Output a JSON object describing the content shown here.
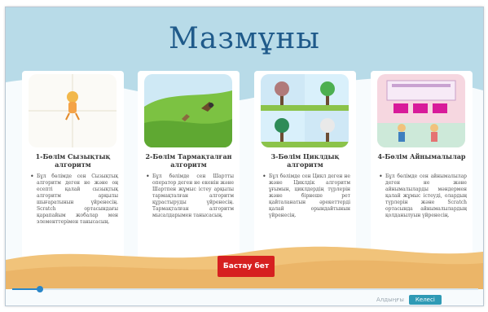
{
  "title": "Мазмұны",
  "cards": [
    {
      "title": "1-Бөлім Сызықтық алгоритм",
      "body": "Бұл бөлімде сен Сызықтық алгоритм деген не және оң есепті қалай сызықтық алгоритм арқылы шығаратынын үйренесің. Scratch ортасындағы қарапайым жобалар мен элементтерімен танысасың."
    },
    {
      "title": "2-Бөлім Тармақталған алгоритм",
      "body": "Бұл бөлімде сен Шартты оператор деген не екенін және Шартпен жұмыс істеу арқылы тармақталған алгоритм құрастыруды үйренесің. Тармақталған алгоритм мысалдарымен танысасың."
    },
    {
      "title": "3-Бөлім Циклдық алгоритм",
      "body": "Бұл бөлімде сен Цикл деген не және Циклдік алгоритм ұғымын, циклдердің түрлерін және бірнеше рет қайталанатын әрекеттерді қалай орындайтынын үйренесің."
    },
    {
      "title": "4-Бөлім Айнымалылар",
      "body": "Бұл бөлімде сен айнымалылар деген не және айнымалыларды мәндермен қалай жұмыс істеуді, олардың түрлерін және Scratch ортасында айнымалылардың қолданылуын үйренесің."
    }
  ],
  "start_button": "Бастау бет",
  "progress": 0.06,
  "nav": {
    "prev": "Алдыңғы",
    "next": "Келесі"
  }
}
